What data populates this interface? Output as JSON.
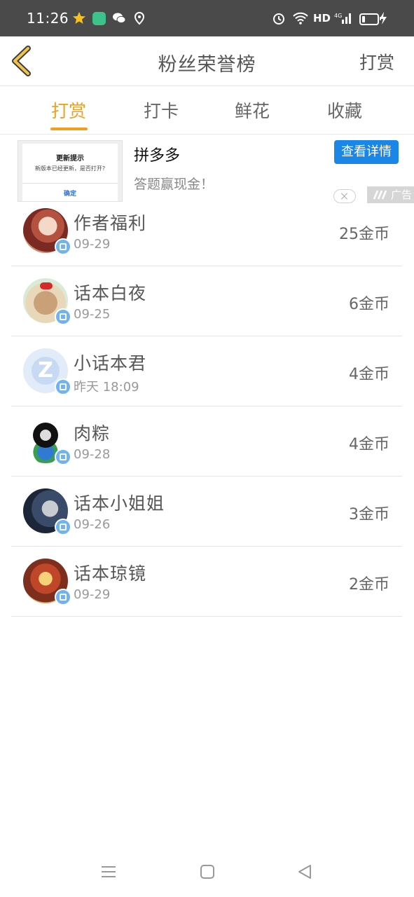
{
  "status_bar": {
    "time": "11:26",
    "hd_label": "HD",
    "network_label": "4G",
    "icons": [
      "star-icon",
      "app-icon",
      "wechat-icon",
      "location-icon",
      "alarm-icon",
      "wifi-icon",
      "signal-icon",
      "battery-icon",
      "charging-icon"
    ]
  },
  "header": {
    "title": "粉丝荣誉榜",
    "right_action": "打赏",
    "back_icon": "chevron-left-icon"
  },
  "tabs": [
    {
      "label": "打赏",
      "active": true
    },
    {
      "label": "打卡",
      "active": false
    },
    {
      "label": "鲜花",
      "active": false
    },
    {
      "label": "收藏",
      "active": false
    }
  ],
  "ad": {
    "title": "拼多多",
    "subtitle": "答题赢现金！",
    "button_label": "查看详情",
    "tag_label": "广告",
    "thumb": {
      "dialog_title": "更新提示",
      "dialog_message": "新版本已经更新，是否打开?",
      "dialog_confirm": "确定"
    }
  },
  "fans": [
    {
      "name": "作者福利",
      "date": "09-29",
      "amount": "25金币"
    },
    {
      "name": "话本白夜",
      "date": "09-25",
      "amount": "6金币"
    },
    {
      "name": "小话本君",
      "date": "昨天 18:09",
      "amount": "4金币"
    },
    {
      "name": "肉粽",
      "date": "09-28",
      "amount": "4金币"
    },
    {
      "name": "话本小姐姐",
      "date": "09-26",
      "amount": "3金币"
    },
    {
      "name": "话本琼镜",
      "date": "09-29",
      "amount": "2金币"
    }
  ],
  "colors": {
    "accent": "#f0a020",
    "ad_button": "#1a86e8",
    "status_bar": "#4a4a4a"
  },
  "nav_bar": {
    "icons": [
      "menu-icon",
      "home-icon",
      "back-icon"
    ]
  }
}
